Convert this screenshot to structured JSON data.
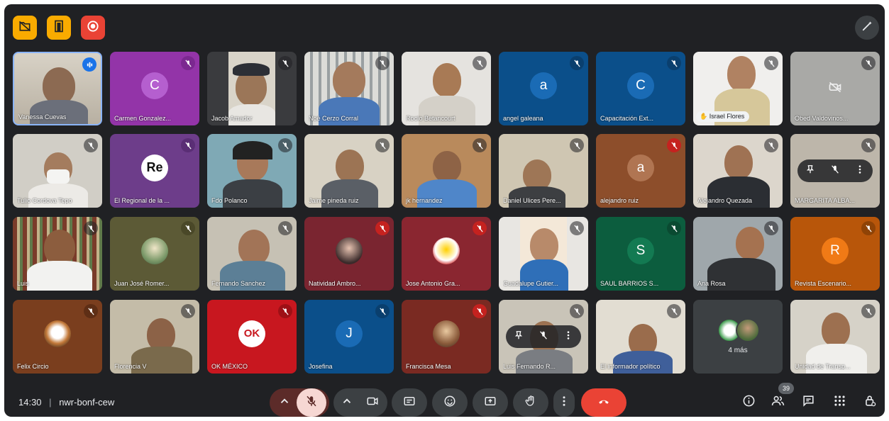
{
  "meeting": {
    "time": "14:30",
    "separator": "|",
    "code": "nwr-bonf-cew",
    "participants_badge": "39"
  },
  "icons": {
    "top_left": [
      "folder-off-icon",
      "door-icon",
      "record-icon"
    ],
    "top_right": "visual-effects-icon",
    "controls": [
      "chevron-up-icon",
      "mic-off-icon",
      "chevron-up-icon",
      "camera-icon",
      "captions-icon",
      "emoji-icon",
      "present-icon",
      "raise-hand-icon",
      "more-vert-icon",
      "end-call-icon"
    ],
    "right": [
      "info-icon",
      "people-icon",
      "chat-icon",
      "apps-icon",
      "host-controls-icon"
    ]
  },
  "colors": {
    "frame": "#202124",
    "recording_yellow": "#f9ab00",
    "record_red": "#ea4335",
    "end_call": "#ea4335",
    "mic_off_active": "#f6d7d3"
  },
  "tiles": [
    {
      "name": "Vanessa Cuevas",
      "muted": false,
      "speaking": true,
      "active": true
    },
    {
      "name": "Carmen Gonzalez...",
      "initial": "C",
      "muted": true
    },
    {
      "name": "Jacob Amador",
      "muted": true
    },
    {
      "name": "Noé Cerzo Corral",
      "muted": true
    },
    {
      "name": "Rocío Betancourt",
      "muted": true
    },
    {
      "name": "angel galeana",
      "initial": "a",
      "muted": true
    },
    {
      "name": "Capacitación Ext...",
      "initial": "C",
      "muted": true
    },
    {
      "name": "Israel Flores",
      "muted": true,
      "hand_raised": true
    },
    {
      "name": "Obed Valdovinos...",
      "muted": true,
      "camera_off": true
    },
    {
      "name": "Tulio Cordova Tepo",
      "muted": true
    },
    {
      "name": "El Regional de la ...",
      "muted": true
    },
    {
      "name": "Fdo Polanco",
      "muted": true
    },
    {
      "name": "Jaime pineda ruiz",
      "muted": true
    },
    {
      "name": "jk hernandez",
      "muted": true
    },
    {
      "name": "Daniel Ulices Pere...",
      "muted": true
    },
    {
      "name": "alejandro ruiz",
      "initial": "a",
      "muted": true
    },
    {
      "name": "Alejandro Quezada",
      "muted": true
    },
    {
      "name": "MARGARITA ALBA...",
      "muted": true,
      "hover_controls": true
    },
    {
      "name": "Luis",
      "muted": true
    },
    {
      "name": "Juan José Romer...",
      "muted": true
    },
    {
      "name": "Fernando Sanchez",
      "muted": true
    },
    {
      "name": "Natividad Ambro...",
      "muted": true
    },
    {
      "name": "Jose Antonio Gra...",
      "muted": true
    },
    {
      "name": "Guadalupe Gutier...",
      "muted": true
    },
    {
      "name": "SAUL BARRIOS S...",
      "initial": "S",
      "muted": true
    },
    {
      "name": "Ana Rosa",
      "muted": true
    },
    {
      "name": "Revista Escenario...",
      "initial": "R",
      "muted": true
    },
    {
      "name": "Felix Circio",
      "muted": true
    },
    {
      "name": "Florencia V",
      "muted": true
    },
    {
      "name": "OK MÉXICO",
      "logo": "OK",
      "muted": true
    },
    {
      "name": "Josefina",
      "initial": "J",
      "muted": true
    },
    {
      "name": "Francisca Mesa",
      "muted": true
    },
    {
      "name": "Luis Fernando R...",
      "muted": true,
      "hover_controls": true
    },
    {
      "name": "El informador político",
      "muted": true
    },
    {
      "name": "4 más",
      "overflow": true
    },
    {
      "name": "Unidad de Transp...",
      "muted": true
    }
  ],
  "logo_text": {
    "tile_11": "Re"
  }
}
